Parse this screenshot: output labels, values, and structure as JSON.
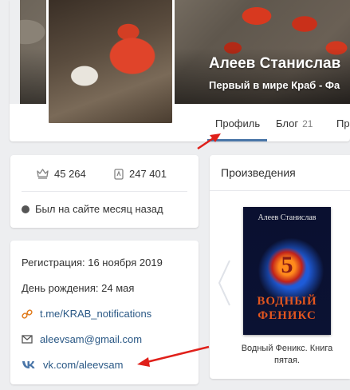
{
  "profile": {
    "name": "Алеев Станислав",
    "subtitle": "Первый в мире Краб - Фа"
  },
  "tabs": [
    {
      "label": "Профиль",
      "active": true
    },
    {
      "label": "Блог",
      "count": "21"
    },
    {
      "label": "Пр"
    }
  ],
  "stats": {
    "followers": "45 264",
    "views": "247 401",
    "last_seen": "Был на сайте месяц назад"
  },
  "info": {
    "registration": "Регистрация: 16 ноября 2019",
    "birthday": "День рождения: 24 мая",
    "telegram": "t.me/KRAB_notifications",
    "email": "aleevsam@gmail.com",
    "vk": "vk.com/aleevsam"
  },
  "works": {
    "title": "Произведения",
    "book": {
      "cover_author": "Алеев Станислав",
      "cover_number": "5",
      "cover_title_1": "ВОДНЫЙ",
      "cover_title_2": "ФЕНИКС",
      "caption": "Водный Феникс. Книга пятая."
    }
  },
  "colors": {
    "accent": "#4a76a8",
    "link": "#2a5885",
    "arrow": "#e0201a",
    "background": "#edeef0"
  }
}
